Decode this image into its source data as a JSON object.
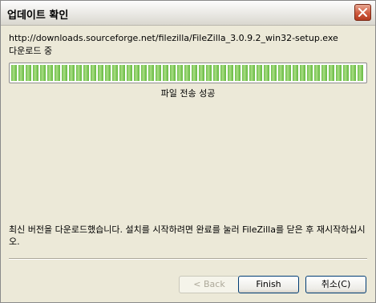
{
  "window": {
    "title": "업데이트 확인"
  },
  "download": {
    "url": "http://downloads.sourceforge.net/filezilla/FileZilla_3.0.9.2_win32-setup.exe",
    "status": "다운로드 중",
    "progress_fraction": 1.0,
    "result": "파일 전송 성공"
  },
  "message": "최신 버전을 다운로드했습니다. 설치를 시작하려면 완료를 눌러 FileZilla를 닫은 후 재시작하십시오.",
  "buttons": {
    "back": "< Back",
    "finish": "Finish",
    "cancel": "취소(C)"
  },
  "icons": {
    "close": "close-icon"
  }
}
